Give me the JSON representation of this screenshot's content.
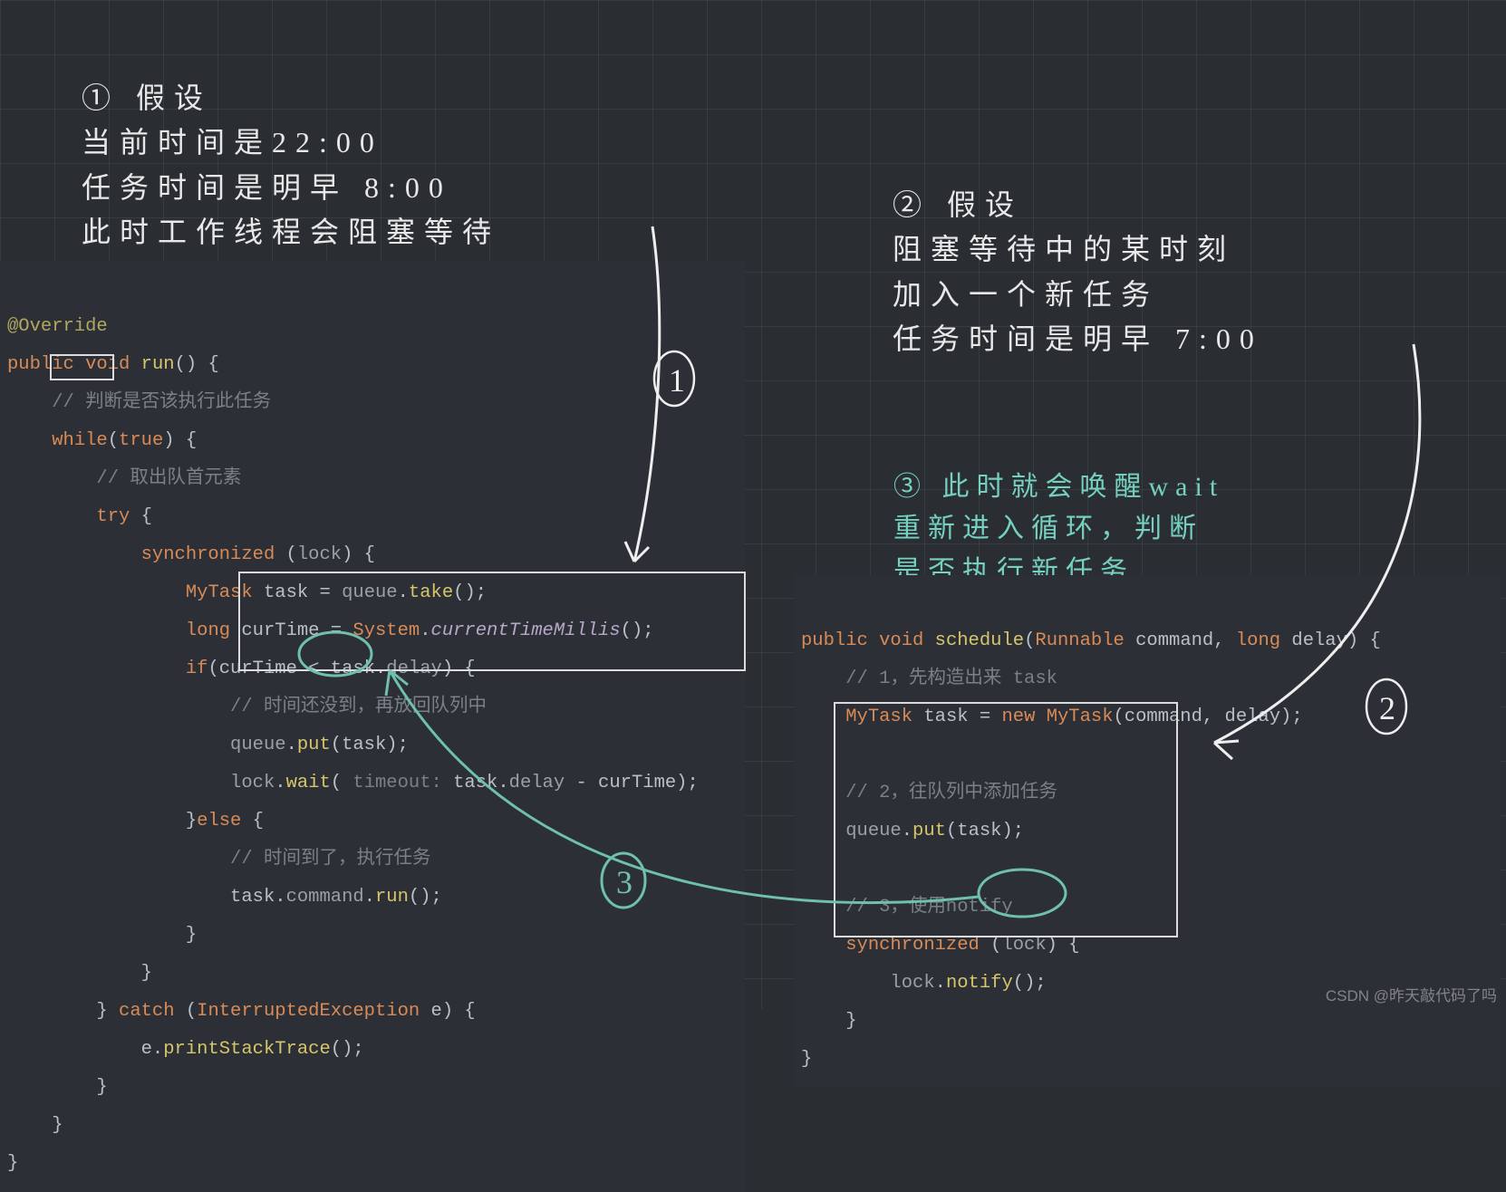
{
  "hw1": {
    "lines": [
      "① 假设",
      "当前时间是22:00",
      "任务时间是明早 8:00",
      "此时工作线程会阻塞等待"
    ]
  },
  "hw2": {
    "lines": [
      "② 假设",
      "阻塞等待中的某时刻",
      "加入一个新任务",
      "任务时间是明早 7:00"
    ]
  },
  "hw3": {
    "lines": [
      "③ 此时就会唤醒wait",
      "重新进入循环，判断",
      "是否执行新任务"
    ]
  },
  "code1": {
    "annotation": "@Override",
    "kw_public": "public",
    "kw_void": "void",
    "fn_run": "run",
    "cmt1": "// 判断是否该执行此任务",
    "kw_while": "while",
    "kw_true": "true",
    "cmt2": "// 取出队首元素",
    "kw_try": "try",
    "kw_sync": "synchronized",
    "id_lock": "lock",
    "type_mytask": "MyTask",
    "id_task": "task",
    "id_queue": "queue",
    "fn_take": "take",
    "kw_long": "long",
    "id_curTime": "curTime",
    "type_system": "System",
    "fn_ctm": "currentTimeMillis",
    "kw_if": "if",
    "fld_delay": "delay",
    "cmt3": "// 时间还没到，再放回队列中",
    "fn_put": "put",
    "fn_wait": "wait",
    "hint_timeout": "timeout:",
    "kw_else": "else",
    "cmt4": "// 时间到了，执行任务",
    "fld_command": "command",
    "fn_run2": "run",
    "kw_catch": "catch",
    "type_ie": "InterruptedException",
    "id_e": "e",
    "fn_pst": "printStackTrace"
  },
  "code2": {
    "kw_public": "public",
    "kw_void": "void",
    "fn_schedule": "schedule",
    "type_runnable": "Runnable",
    "id_command": "command",
    "kw_long": "long",
    "id_delay": "delay",
    "cmt1": "// 1，先构造出来 task",
    "type_mytask": "MyTask",
    "id_task": "task",
    "kw_new": "new",
    "cmt2": "// 2，往队列中添加任务",
    "id_queue": "queue",
    "fn_put": "put",
    "cmt3": "// 3，使用notify",
    "kw_sync": "synchronized",
    "id_lock": "lock",
    "fn_notify": "notify"
  },
  "watermark": "CSDN @昨天敲代码了吗"
}
